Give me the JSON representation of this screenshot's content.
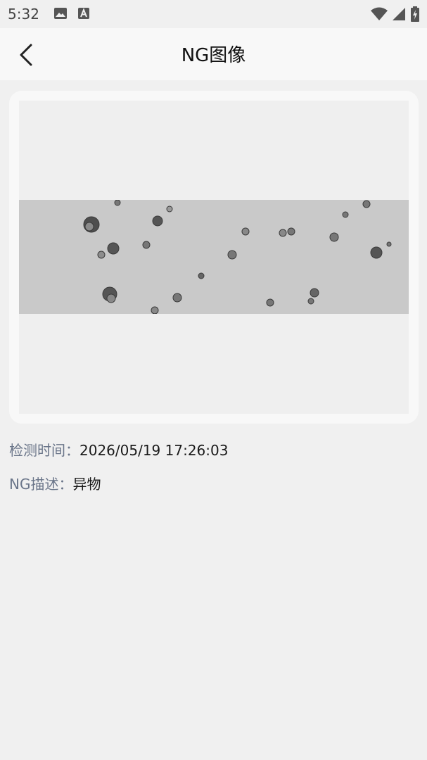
{
  "status_bar": {
    "time": "5:32",
    "icons": [
      "image-icon",
      "text-a-icon",
      "wifi-icon",
      "signal-icon",
      "battery-icon"
    ]
  },
  "header": {
    "title": "NG图像",
    "back_icon": "chevron-left-icon"
  },
  "ng_image": {
    "description": "gray inspection image strip with dark particle defects"
  },
  "info": {
    "detect_time_label": "检测时间：",
    "detect_time_value": "2026/05/19 17:26:03",
    "ng_desc_label": "NG描述：",
    "ng_desc_value": "异物"
  },
  "colors": {
    "background": "#f0f0f0",
    "label": "#6a7589",
    "value": "#1a1a1a"
  }
}
